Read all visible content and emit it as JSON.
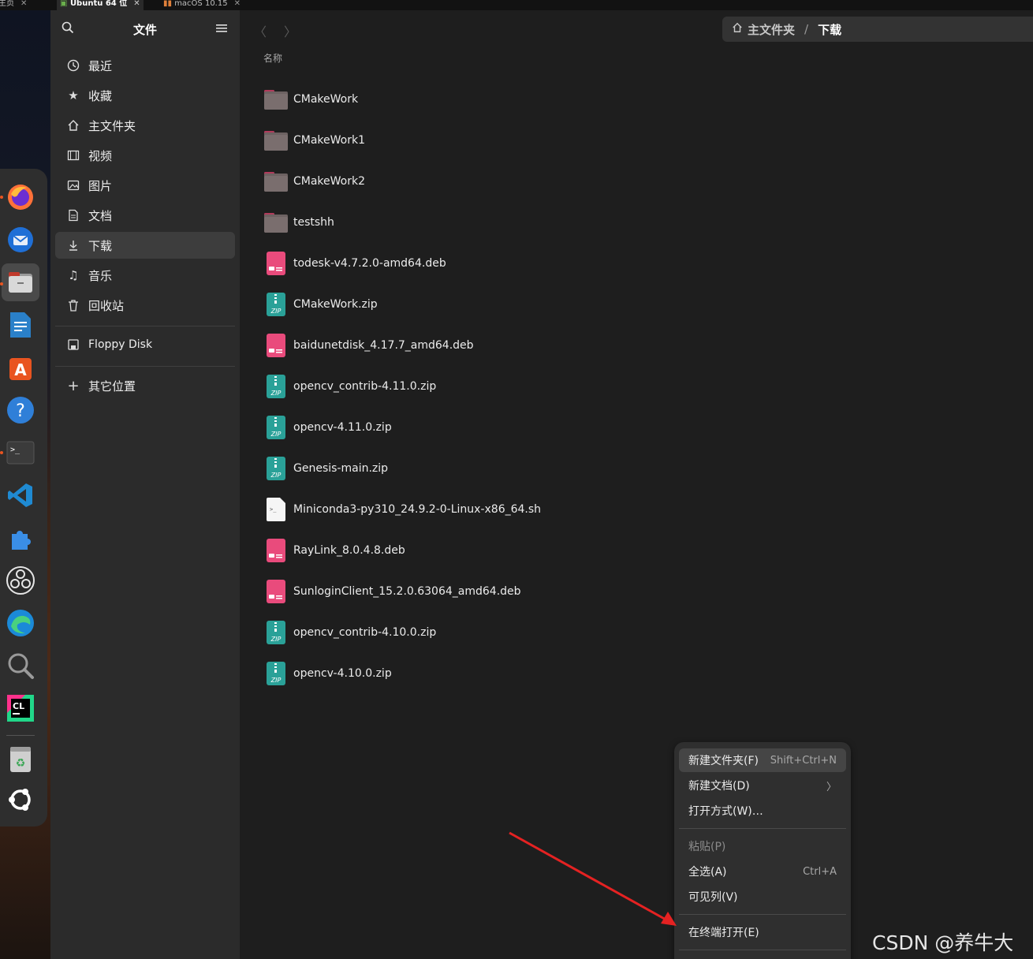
{
  "vm_tabs": [
    {
      "label": "主页",
      "active": false
    },
    {
      "label": "Ubuntu 64 位",
      "active": true
    },
    {
      "label": "macOS 10.15",
      "active": false
    }
  ],
  "dock": {
    "apps": [
      "firefox-icon",
      "thunderbird-icon",
      "files-icon",
      "libreoffice-writer-icon",
      "app-center-icon",
      "help-icon",
      "terminal-icon",
      "vscode-icon",
      "extensions-icon",
      "obs-icon",
      "edge-icon",
      "search-icon",
      "clion-icon",
      "trash-icon",
      "ubuntu-icon"
    ]
  },
  "sidebar": {
    "title": "文件",
    "items": [
      {
        "label": "最近",
        "icon": "recent-icon"
      },
      {
        "label": "收藏",
        "icon": "star-icon"
      },
      {
        "label": "主文件夹",
        "icon": "home-icon"
      },
      {
        "label": "视频",
        "icon": "video-icon"
      },
      {
        "label": "图片",
        "icon": "picture-icon"
      },
      {
        "label": "文档",
        "icon": "document-icon"
      },
      {
        "label": "下载",
        "icon": "download-icon",
        "selected": true
      },
      {
        "label": "音乐",
        "icon": "music-icon"
      },
      {
        "label": "回收站",
        "icon": "trash-icon"
      }
    ],
    "devices": [
      {
        "label": "Floppy Disk",
        "icon": "floppy-icon"
      }
    ],
    "other": {
      "label": "其它位置",
      "icon": "plus-icon"
    }
  },
  "pathbar": {
    "home": "主文件夹",
    "separator": "/",
    "current": "下载"
  },
  "column_header": "名称",
  "files": [
    {
      "name": "CMakeWork",
      "type": "folder"
    },
    {
      "name": "CMakeWork1",
      "type": "folder"
    },
    {
      "name": "CMakeWork2",
      "type": "folder"
    },
    {
      "name": "testshh",
      "type": "folder"
    },
    {
      "name": "todesk-v4.7.2.0-amd64.deb",
      "type": "deb"
    },
    {
      "name": "CMakeWork.zip",
      "type": "zip"
    },
    {
      "name": "baidunetdisk_4.17.7_amd64.deb",
      "type": "deb"
    },
    {
      "name": "opencv_contrib-4.11.0.zip",
      "type": "zip"
    },
    {
      "name": "opencv-4.11.0.zip",
      "type": "zip"
    },
    {
      "name": "Genesis-main.zip",
      "type": "zip"
    },
    {
      "name": "Miniconda3-py310_24.9.2-0-Linux-x86_64.sh",
      "type": "sh"
    },
    {
      "name": "RayLink_8.0.4.8.deb",
      "type": "deb"
    },
    {
      "name": "SunloginClient_15.2.0.63064_amd64.deb",
      "type": "deb"
    },
    {
      "name": "opencv_contrib-4.10.0.zip",
      "type": "zip"
    },
    {
      "name": "opencv-4.10.0.zip",
      "type": "zip"
    }
  ],
  "context_menu": {
    "new_folder": {
      "label": "新建文件夹(F)",
      "accel": "Shift+Ctrl+N"
    },
    "new_document": {
      "label": "新建文档(D)",
      "accel": "〉"
    },
    "open_with": {
      "label": "打开方式(W)…"
    },
    "paste": {
      "label": "粘贴(P)"
    },
    "select_all": {
      "label": "全选(A)",
      "accel": "Ctrl+A"
    },
    "visible_columns": {
      "label": "可见列(V)"
    },
    "open_terminal": {
      "label": "在终端打开(E)"
    }
  },
  "watermark": "CSDN @养牛大人",
  "colors": {
    "accent": "#e95420",
    "arrow": "#e52222",
    "folder": "#7a6a6a",
    "deb": "#e94b7c",
    "zip": "#2aa198"
  }
}
